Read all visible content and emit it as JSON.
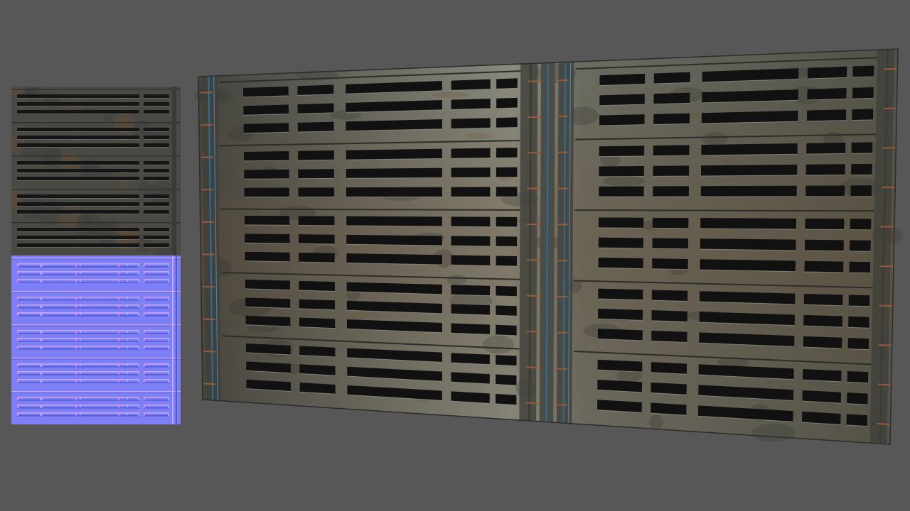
{
  "viewport": {
    "background_color": "#575757"
  },
  "texture_swatches": [
    {
      "kind": "diffuse",
      "base_color": "#4a4a45",
      "rust_color": "#6b4a34",
      "slot_color": "#151515"
    },
    {
      "kind": "normal",
      "base_color": "#7f7ff5",
      "edge_light_color": "#c8a8ff",
      "edge_dark_color": "#4e5ad8"
    }
  ],
  "panel_preview": {
    "metal_color": "#5d6058",
    "metal_light_color": "#8a8c80",
    "rust_color": "#6e5238",
    "slot_color": "#111111",
    "cable_color": "#2c6e9a",
    "pipe_color": "#9a5a3a",
    "slot_rows_per_band": 3,
    "band_count": 5,
    "slot_columns": [
      3,
      6,
      3,
      3
    ]
  }
}
